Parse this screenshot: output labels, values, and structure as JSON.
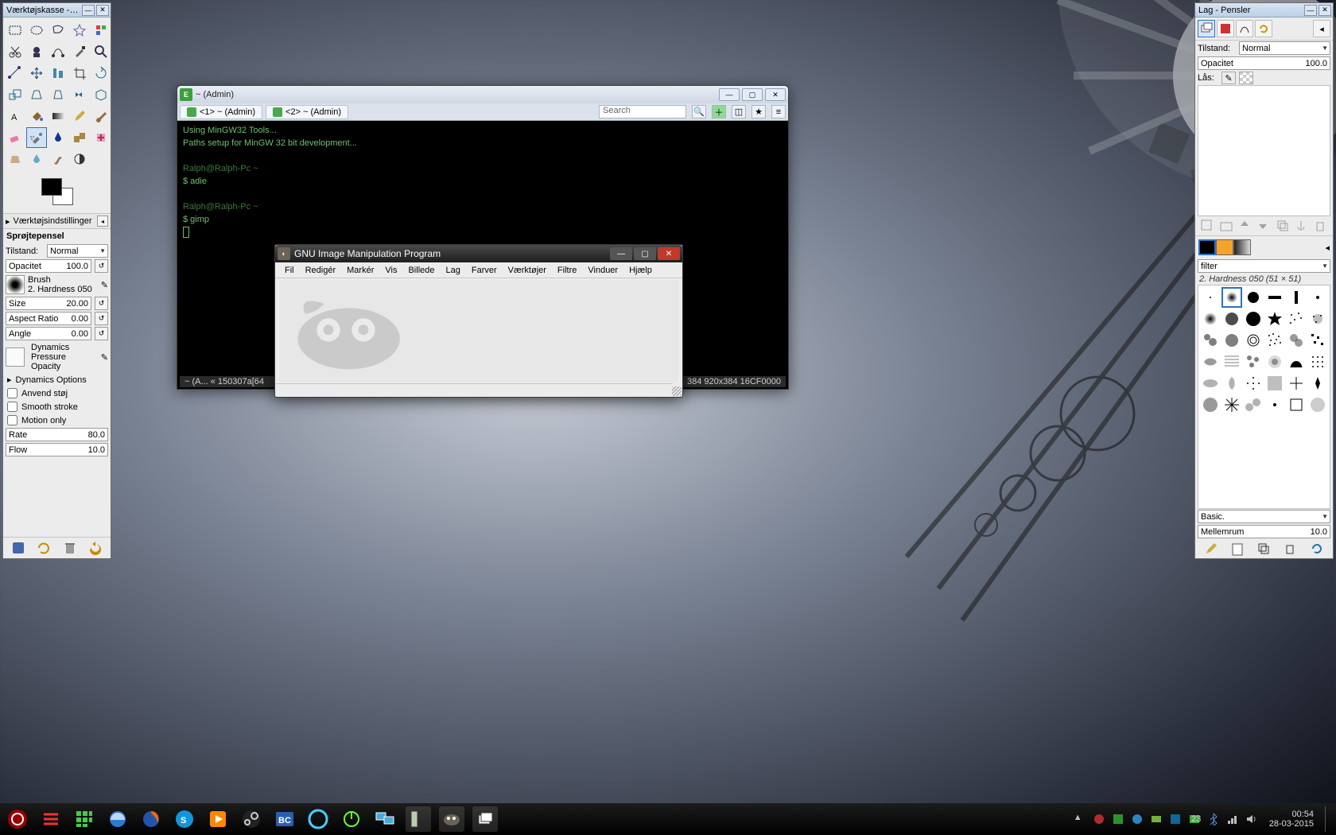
{
  "toolbox": {
    "title": "Værktøjskasse - Værktøjs...",
    "options_header": "Værktøjsindstillinger",
    "current_tool": "Sprøjtepensel",
    "mode_label": "Tilstand:",
    "mode_value": "Normal",
    "opacity_label": "Opacitet",
    "opacity_value": "100.0",
    "brush_label": "Brush",
    "brush_name": "2. Hardness 050",
    "size_label": "Size",
    "size_value": "20.00",
    "aspect_label": "Aspect Ratio",
    "aspect_value": "0.00",
    "angle_label": "Angle",
    "angle_value": "0.00",
    "dynamics_label": "Dynamics",
    "dynamics_value": "Pressure Opacity",
    "dyn_options": "Dynamics Options",
    "noise": "Anvend støj",
    "smooth": "Smooth stroke",
    "motion": "Motion only",
    "rate_label": "Rate",
    "rate_value": "80.0",
    "flow_label": "Flow",
    "flow_value": "10.0"
  },
  "terminal": {
    "title": "~ (Admin)",
    "tab1": "<1> ~ (Admin)",
    "tab2": "<2> ~ (Admin)",
    "search_placeholder": "Search",
    "line1": "Using MinGW32 Tools...",
    "line2": "Paths setup for MinGW 32 bit development...",
    "prompt1": "Ralph@Ralph-Pc ~",
    "cmd1": "$ adie",
    "prompt2": "Ralph@Ralph-Pc ~",
    "cmd2": "$ gimp",
    "status_left": "~ (A...  « 150307a[64",
    "status_right": "384 920x384 16CF0000"
  },
  "gimp": {
    "title": "GNU Image Manipulation Program",
    "menus": [
      "Fil",
      "Redigér",
      "Markér",
      "Vis",
      "Billede",
      "Lag",
      "Farver",
      "Værktøjer",
      "Filtre",
      "Vinduer",
      "Hjælp"
    ]
  },
  "layers": {
    "title": "Lag - Pensler",
    "mode_label": "Tilstand:",
    "mode_value": "Normal",
    "opacity_label": "Opacitet",
    "opacity_value": "100.0",
    "lock_label": "Lås:",
    "filter_placeholder": "filter",
    "brush_info": "2. Hardness 050 (51 × 51)",
    "basic_label": "Basic.",
    "spacing_label": "Mellemrum",
    "spacing_value": "10.0",
    "swatches": [
      "#000000",
      "#f4a428",
      "#888888"
    ]
  },
  "clock": {
    "time": "00:54",
    "date": "28-03-2015"
  },
  "taskbar_apps": [
    "start",
    "menu",
    "grid",
    "ie",
    "firefox",
    "skype",
    "wmp",
    "steam",
    "bc",
    "c",
    "power",
    "screens",
    "gimp-toolbox",
    "gimp-main",
    "gimp-layers"
  ]
}
